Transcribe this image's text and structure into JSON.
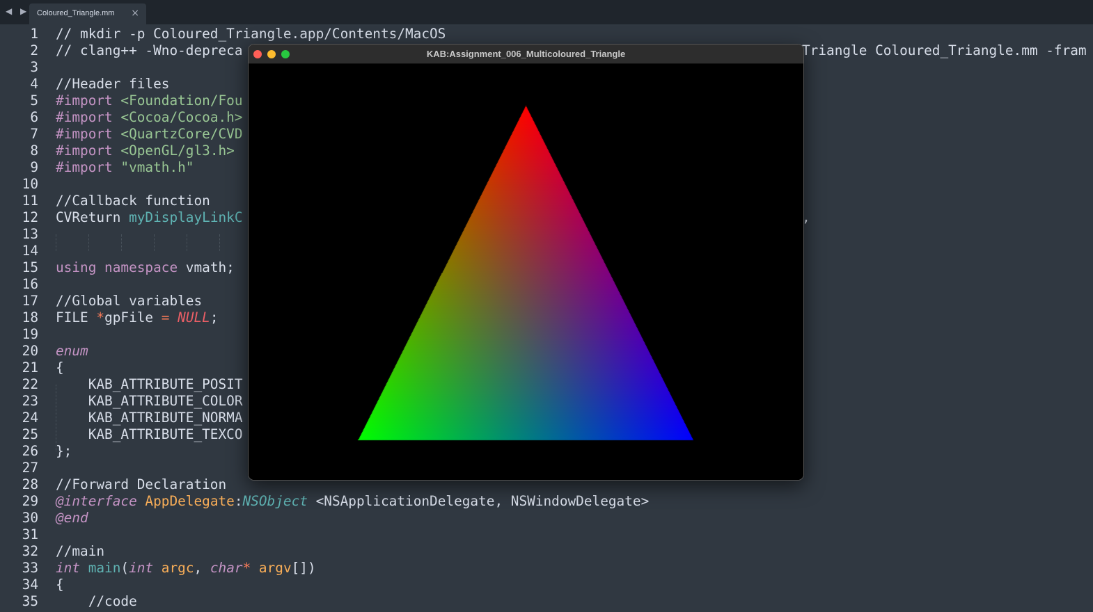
{
  "tabbar": {
    "nav_arrows": "◀ ▶",
    "tab_title": "Coloured_Triangle.mm",
    "close_glyph": "×"
  },
  "gl_window": {
    "title": "KAB:Assignment_006_Multicoloured_Triangle",
    "vertex_colors": {
      "top": "#ff0000",
      "bottom_left": "#00ff00",
      "bottom_right": "#0000ff"
    },
    "traffic_light_colors": [
      "#ff5f57",
      "#febc2e",
      "#28c840"
    ]
  },
  "theme": {
    "background": "#303841",
    "tabbar_background": "#1f252c",
    "text": "#d8dee9",
    "keyword": "#c594c5",
    "string": "#99c794",
    "function": "#5fb3b3",
    "type": "#f9ae58",
    "constant": "#ec5f66"
  },
  "code_lines": [
    {
      "n": "1",
      "segs": [
        {
          "t": "// mkdir -p Coloured_Triangle.app/Contents/MacOS",
          "c": "cmt"
        }
      ]
    },
    {
      "n": "2",
      "segs": [
        {
          "t": "// clang++ -Wno-depreca",
          "c": "cmt"
        }
      ],
      "right": "Triangle Coloured_Triangle.mm -fram"
    },
    {
      "n": "3",
      "segs": []
    },
    {
      "n": "4",
      "segs": [
        {
          "t": "//Header files",
          "c": "cmt"
        }
      ]
    },
    {
      "n": "5",
      "segs": [
        {
          "t": "#import ",
          "c": "kw"
        },
        {
          "t": "<Foundation/Fou",
          "c": "inc"
        }
      ]
    },
    {
      "n": "6",
      "segs": [
        {
          "t": "#import ",
          "c": "kw"
        },
        {
          "t": "<Cocoa/Cocoa.h>",
          "c": "inc"
        }
      ]
    },
    {
      "n": "7",
      "segs": [
        {
          "t": "#import ",
          "c": "kw"
        },
        {
          "t": "<QuartzCore/CVD",
          "c": "inc"
        }
      ]
    },
    {
      "n": "8",
      "segs": [
        {
          "t": "#import ",
          "c": "kw"
        },
        {
          "t": "<OpenGL/gl3.h>",
          "c": "inc"
        }
      ]
    },
    {
      "n": "9",
      "segs": [
        {
          "t": "#import ",
          "c": "kw"
        },
        {
          "t": "\"vmath.h\"",
          "c": "inc"
        }
      ]
    },
    {
      "n": "10",
      "segs": []
    },
    {
      "n": "11",
      "segs": [
        {
          "t": "//Callback function",
          "c": "cmt"
        }
      ]
    },
    {
      "n": "12",
      "segs": [
        {
          "t": "CVReturn ",
          "c": "punct"
        },
        {
          "t": "myDisplayLinkC",
          "c": "fn"
        }
      ],
      "right": ","
    },
    {
      "n": "13",
      "segs": []
    },
    {
      "n": "14",
      "segs": []
    },
    {
      "n": "15",
      "segs": [
        {
          "t": "using namespace ",
          "c": "kw"
        },
        {
          "t": "vmath;",
          "c": "punct"
        }
      ]
    },
    {
      "n": "16",
      "segs": []
    },
    {
      "n": "17",
      "segs": [
        {
          "t": "//Global variables",
          "c": "cmt"
        }
      ]
    },
    {
      "n": "18",
      "segs": [
        {
          "t": "FILE ",
          "c": "punct"
        },
        {
          "t": "*",
          "c": "op"
        },
        {
          "t": "gpFile ",
          "c": "punct"
        },
        {
          "t": "= ",
          "c": "op"
        },
        {
          "t": "NULL",
          "c": "nul"
        },
        {
          "t": ";",
          "c": "punct"
        }
      ]
    },
    {
      "n": "19",
      "segs": []
    },
    {
      "n": "20",
      "segs": [
        {
          "t": "enum",
          "c": "kw it"
        }
      ]
    },
    {
      "n": "21",
      "segs": [
        {
          "t": "{",
          "c": "punct"
        }
      ]
    },
    {
      "n": "22",
      "segs": [
        {
          "t": "    KAB_ATTRIBUTE_POSIT",
          "c": "punct"
        }
      ]
    },
    {
      "n": "23",
      "segs": [
        {
          "t": "    KAB_ATTRIBUTE_COLOR",
          "c": "punct"
        }
      ]
    },
    {
      "n": "24",
      "segs": [
        {
          "t": "    KAB_ATTRIBUTE_NORMA",
          "c": "punct"
        }
      ]
    },
    {
      "n": "25",
      "segs": [
        {
          "t": "    KAB_ATTRIBUTE_TEXCO",
          "c": "punct"
        }
      ]
    },
    {
      "n": "26",
      "segs": [
        {
          "t": "};",
          "c": "punct"
        }
      ]
    },
    {
      "n": "27",
      "segs": []
    },
    {
      "n": "28",
      "segs": [
        {
          "t": "//Forward Declaration",
          "c": "cmt"
        }
      ]
    },
    {
      "n": "29",
      "segs": [
        {
          "t": "@interface ",
          "c": "kw it"
        },
        {
          "t": "AppDelegate",
          "c": "ty"
        },
        {
          "t": ":",
          "c": "punct"
        },
        {
          "t": "NSObject ",
          "c": "tl"
        },
        {
          "t": "<NSApplicationDelegate, NSWindowDelegate>",
          "c": "punct"
        }
      ]
    },
    {
      "n": "30",
      "segs": [
        {
          "t": "@end",
          "c": "kw it"
        }
      ]
    },
    {
      "n": "31",
      "segs": []
    },
    {
      "n": "32",
      "segs": [
        {
          "t": "//main",
          "c": "cmt"
        }
      ]
    },
    {
      "n": "33",
      "segs": [
        {
          "t": "int ",
          "c": "kw it"
        },
        {
          "t": "main",
          "c": "fn"
        },
        {
          "t": "(",
          "c": "punct"
        },
        {
          "t": "int ",
          "c": "kw it"
        },
        {
          "t": "argc",
          "c": "ty"
        },
        {
          "t": ", ",
          "c": "punct"
        },
        {
          "t": "char",
          "c": "kw it"
        },
        {
          "t": "* ",
          "c": "op"
        },
        {
          "t": "argv",
          "c": "ty"
        },
        {
          "t": "[])",
          "c": "punct"
        }
      ]
    },
    {
      "n": "34",
      "segs": [
        {
          "t": "{",
          "c": "punct"
        }
      ]
    },
    {
      "n": "35",
      "segs": [
        {
          "t": "    //code",
          "c": "cmt"
        }
      ]
    }
  ]
}
